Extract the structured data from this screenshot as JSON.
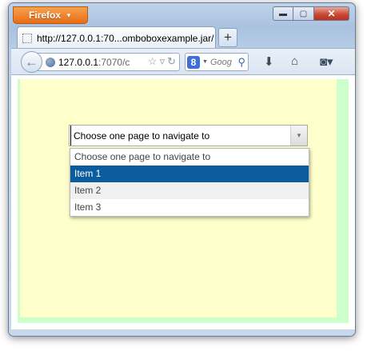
{
  "browser": {
    "app_button_label": "Firefox",
    "tab_title": "http://127.0.0.1:70...omboboxexample.jar/",
    "new_tab_label": "+",
    "url_host": "127.0.0.1",
    "url_rest": ":7070/c",
    "search_placeholder": "Goog",
    "search_engine_letter": "8",
    "window_controls": {
      "minimize": "▬",
      "maximize": "▢",
      "close": "✕"
    }
  },
  "combobox": {
    "value": "Choose one page to navigate to",
    "options": [
      {
        "label": "Choose one page to navigate to",
        "state": "normal"
      },
      {
        "label": "Item 1",
        "state": "selected"
      },
      {
        "label": "Item 2",
        "state": "alt"
      },
      {
        "label": "Item 3",
        "state": "normal"
      }
    ]
  },
  "colors": {
    "page_green": "#ccffcc",
    "page_yellow": "#ffffcc",
    "selected_option": "#0a5c9d"
  }
}
